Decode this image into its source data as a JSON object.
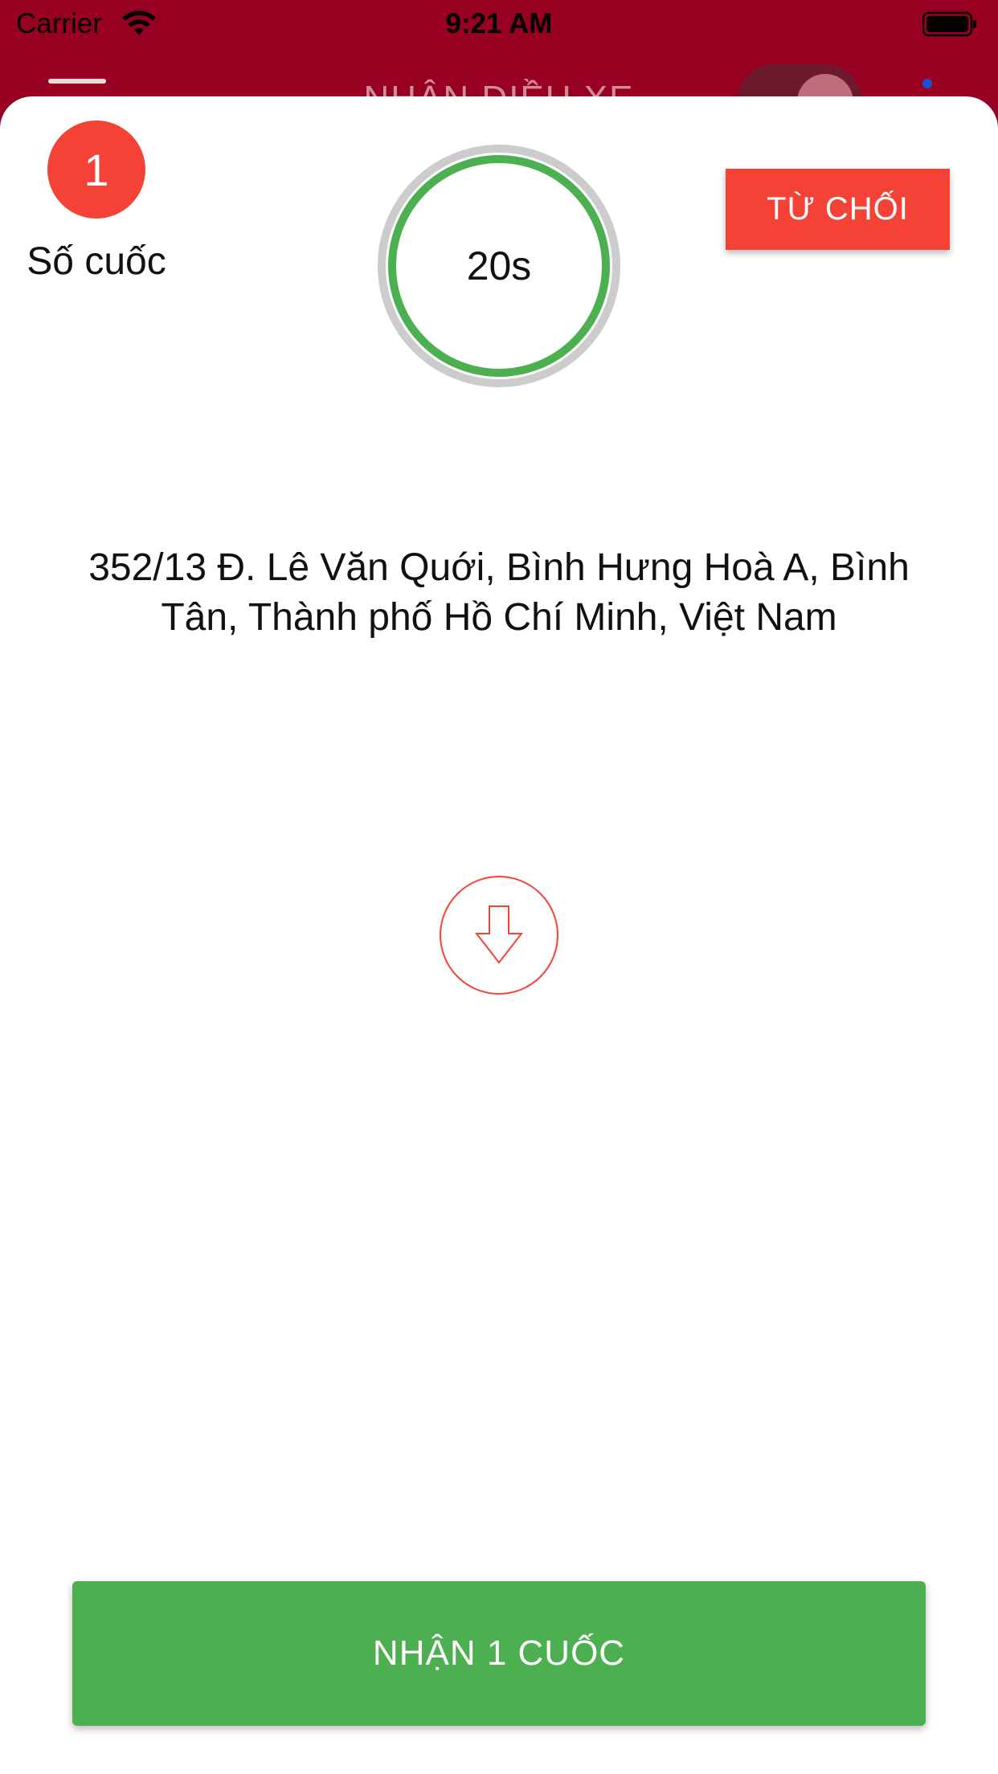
{
  "status_bar": {
    "carrier": "Carrier",
    "time": "9:21 AM"
  },
  "header": {
    "title": "NHẬN ĐIỀU XE",
    "toggle_state": "on"
  },
  "ride": {
    "count": "1",
    "count_label": "Số cuốc",
    "timer_text": "20s",
    "reject_label": "TỪ CHỐI",
    "address": "352/13 Đ. Lê Văn Quới, Bình Hưng Hoà A, Bình Tân, Thành phố Hồ Chí Minh, Việt Nam",
    "accept_label": "NHẬN 1 CUỐC"
  },
  "colors": {
    "header_bg": "#970020",
    "accent_red": "#f44336",
    "accent_green": "#4caf50"
  }
}
